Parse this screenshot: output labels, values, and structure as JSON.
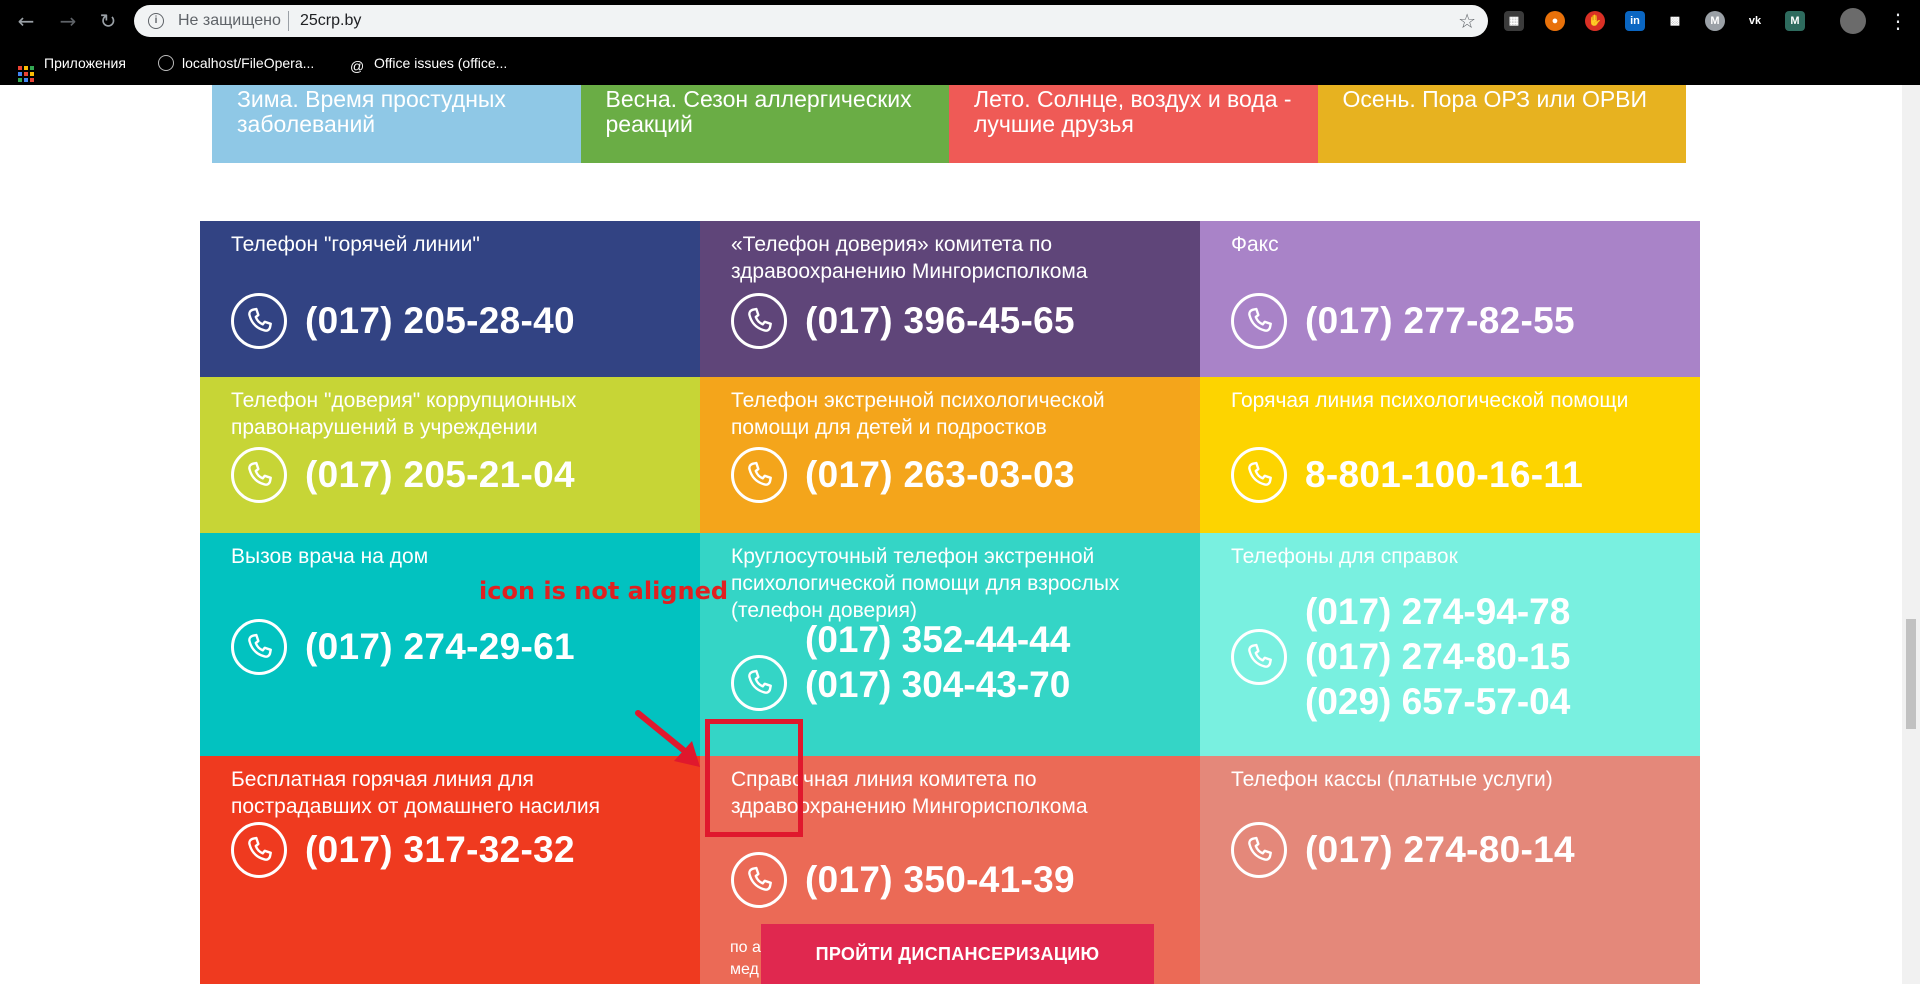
{
  "browser": {
    "security_label": "Не защищено",
    "url": "25crp.by",
    "bookmarks": [
      {
        "label": "Приложения"
      },
      {
        "label": "localhost/FileOpera..."
      },
      {
        "label": "Office issues (office..."
      }
    ]
  },
  "seasons": [
    {
      "label": "Зима. Время простудных заболеваний",
      "color": "#8fc8e6"
    },
    {
      "label": "Весна. Сезон аллергических реакций",
      "color": "#6aad45"
    },
    {
      "label": "Лето. Солнце, воздух и вода - лучшие друзья",
      "color": "#ef5a56"
    },
    {
      "label": "Осень. Пора ОРЗ или ОРВИ",
      "color": "#e7b220"
    }
  ],
  "contacts": [
    {
      "label": "Телефон \"горячей линии\"",
      "numbers": [
        "(017) 205-28-40"
      ],
      "color": "#324383"
    },
    {
      "label": "«Телефон доверия» комитета по здравоохранению Мингорисполкома",
      "numbers": [
        "(017) 396-45-65"
      ],
      "color": "#5f4579"
    },
    {
      "label": "Факс",
      "numbers": [
        "(017) 277-82-55"
      ],
      "color": "#a983c8"
    },
    {
      "label": "Телефон \"доверия\" коррупционных правонарушений в учреждении",
      "numbers": [
        "(017) 205-21-04"
      ],
      "color": "#c7d536"
    },
    {
      "label": "Телефон экстренной психологической помощи для детей и подростков",
      "numbers": [
        "(017) 263-03-03"
      ],
      "color": "#f4a51b"
    },
    {
      "label": "Горячая линия психологической помощи",
      "numbers": [
        "8-801-100-16-11"
      ],
      "color": "#fdd400"
    },
    {
      "label": "Вызов врача на дом",
      "numbers": [
        "(017) 274-29-61"
      ],
      "color": "#02c2c0"
    },
    {
      "label": "Круглосуточный телефон экстренной психологической помощи для взрослых (телефон доверия)",
      "numbers": [
        "(017) 352-44-44",
        "(017) 304-43-70"
      ],
      "color": "#34d5c6"
    },
    {
      "label": "Телефоны для справок",
      "numbers": [
        "(017) 274-94-78",
        "(017) 274-80-15",
        "(029) 657-57-04"
      ],
      "color": "#79f0e0"
    },
    {
      "label": "Бесплатная горячая линия для пострадавших от домашнего насилия",
      "numbers": [
        "(017) 317-32-32"
      ],
      "color": "#ef3a1f"
    },
    {
      "label": "Справочная линия комитета по здравоохранению Мингорисполкома",
      "numbers": [
        "(017) 350-41-39"
      ],
      "color": "#eb6a56"
    },
    {
      "label": "Телефон кассы (платные услуги)",
      "numbers": [
        "(017) 274-80-14"
      ],
      "color": "#e4887a"
    }
  ],
  "cell_footer_text": "по а\nмед",
  "annotation": {
    "text": "icon is not aligned",
    "color": "#e02020"
  },
  "cta": {
    "label": "ПРОЙТИ ДИСПАНСЕРИЗАЦИЮ",
    "color": "#e0284f"
  }
}
